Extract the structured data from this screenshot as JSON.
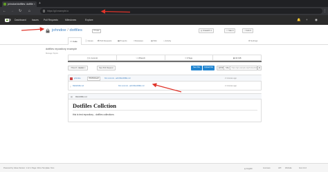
{
  "browser": {
    "tab_title": "johndoe/dotfiles: dotfile",
    "url": "https://git​.example.io"
  },
  "nav": {
    "links": [
      "Dashboard",
      "Issues",
      "Pull Requests",
      "Milestones",
      "Explore"
    ]
  },
  "repo": {
    "owner": "johndoe",
    "separator": "/",
    "name": "dotfiles",
    "badge": "Private",
    "unwatch_label": "Unwatch",
    "unwatch_count": "1",
    "star_label": "Star",
    "star_count": "0",
    "fork_label": "Fork",
    "fork_count": "0",
    "tabs": [
      "<> Code",
      "Issues",
      "Pull Requests",
      "Projects",
      "Releases",
      "Wiki",
      "Activity",
      "Settings"
    ],
    "description": "dotfiles repository example",
    "topics": "Manage Topics",
    "stats": [
      "1 Commit",
      "1 Branch",
      "0 Tags",
      "30 KiB"
    ],
    "branch_label": "Branch:",
    "branch": "master",
    "new_pr": "New Pull Request",
    "new_file": "New File",
    "upload_file": "Upload File",
    "https_btn": "HTTPS",
    "ssh_btn": "SSH",
    "clone_url": "https://git.example.io/johndoe/dotfiles.git"
  },
  "commit": {
    "author": "johndoe",
    "sha": "862f6d4ae8",
    "message": "first commit - add README.md",
    "time": "2 minutes ago"
  },
  "files": [
    {
      "name": "README.md",
      "message": "first commit - add README.md",
      "time": "2 minutes ago"
    }
  ],
  "readme": {
    "filename": "README.md",
    "title": "Dotfiles Collction",
    "body": "this is test repository - dotfiles collections"
  },
  "footer": {
    "left": "Powered by Gitea Version: 1.12.1 Page: 23ms Template: 6ms",
    "language": "English",
    "links": [
      "Licenses",
      "API",
      "Website",
      "Go1.14.2"
    ]
  },
  "colors": {
    "accent": "#4183c4",
    "annotation_arrow": "#e0342a",
    "primary_button": "#2185d0"
  }
}
